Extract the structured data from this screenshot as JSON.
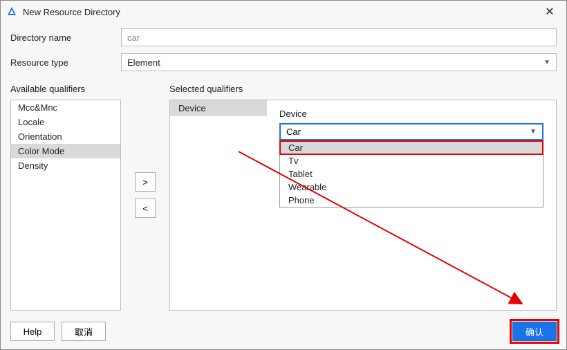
{
  "window": {
    "title": "New Resource Directory"
  },
  "form": {
    "dir_label": "Directory name",
    "dir_value": "car",
    "type_label": "Resource type",
    "type_value": "Element"
  },
  "available": {
    "title": "Available qualifiers",
    "items": [
      "Mcc&Mnc",
      "Locale",
      "Orientation",
      "Color Mode",
      "Density"
    ],
    "selected_index": 3
  },
  "move": {
    "add": ">",
    "remove": "<"
  },
  "selected": {
    "title": "Selected qualifiers",
    "items": [
      "Device"
    ]
  },
  "device": {
    "label": "Device",
    "value": "Car",
    "options": [
      "Car",
      "Tv",
      "Tablet",
      "Wearable",
      "Phone"
    ],
    "highlight_index": 0
  },
  "footer": {
    "help": "Help",
    "cancel": "取消",
    "ok": "确认"
  },
  "colors": {
    "accent": "#1a74e8",
    "annotation": "#e60000"
  }
}
